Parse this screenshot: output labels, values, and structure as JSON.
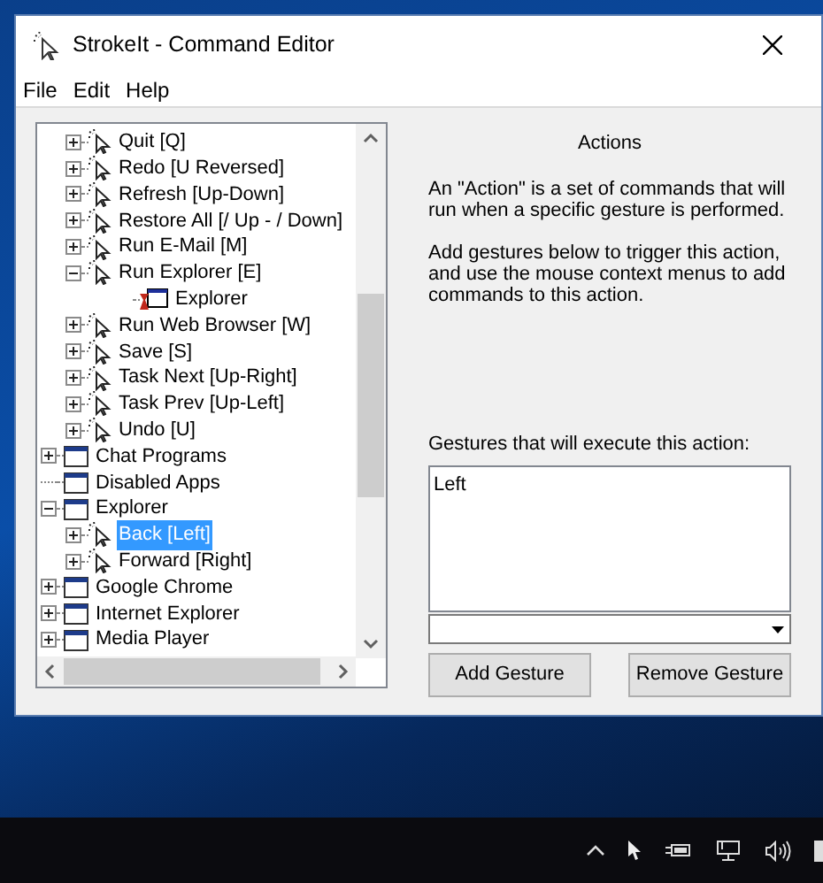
{
  "window": {
    "title": "StrokeIt - Command Editor"
  },
  "menu": [
    "File",
    "Edit",
    "Help"
  ],
  "tree": {
    "items": [
      {
        "label": "Quit [Q]",
        "kind": "action",
        "expanded": false,
        "selected": false
      },
      {
        "label": "Redo [U Reversed]",
        "kind": "action",
        "expanded": false,
        "selected": false
      },
      {
        "label": "Refresh [Up-Down]",
        "kind": "action",
        "expanded": false,
        "selected": false
      },
      {
        "label": "Restore All [/ Up - / Down]",
        "kind": "action",
        "expanded": false,
        "selected": false
      },
      {
        "label": "Run E-Mail [M]",
        "kind": "action",
        "expanded": false,
        "selected": false
      },
      {
        "label": "Run Explorer [E]",
        "kind": "action",
        "expanded": true,
        "selected": false,
        "children": [
          {
            "label": "Explorer",
            "kind": "command",
            "selected": false
          }
        ]
      },
      {
        "label": "Run Web Browser [W]",
        "kind": "action",
        "expanded": false,
        "selected": false
      },
      {
        "label": "Save [S]",
        "kind": "action",
        "expanded": false,
        "selected": false
      },
      {
        "label": "Task Next [Up-Right]",
        "kind": "action",
        "expanded": false,
        "selected": false
      },
      {
        "label": "Task Prev [Up-Left]",
        "kind": "action",
        "expanded": false,
        "selected": false
      },
      {
        "label": "Undo [U]",
        "kind": "action",
        "expanded": false,
        "selected": false
      },
      {
        "label": "Chat Programs",
        "kind": "group",
        "expanded": false,
        "selected": false
      },
      {
        "label": "Disabled Apps",
        "kind": "group",
        "selected": false
      },
      {
        "label": "Explorer",
        "kind": "group",
        "expanded": true,
        "selected": false,
        "children": [
          {
            "label": "Back [Left]",
            "kind": "action",
            "expanded": false,
            "selected": true
          },
          {
            "label": "Forward [Right]",
            "kind": "action",
            "expanded": false,
            "selected": false
          }
        ]
      },
      {
        "label": "Google Chrome",
        "kind": "group",
        "expanded": false,
        "selected": false
      },
      {
        "label": "Internet Explorer",
        "kind": "group",
        "expanded": false,
        "selected": false
      },
      {
        "label": "Media Player",
        "kind": "group",
        "expanded": false,
        "selected": false
      }
    ]
  },
  "panel": {
    "heading": "Actions",
    "paragraphs": [
      "An \"Action\" is a set of commands that will run when a specific gesture is performed.",
      "Add gestures below to trigger this action, and use the mouse context menus to add commands to this action."
    ],
    "gestures_label": "Gestures that will execute this action:",
    "gestures": [
      "Left"
    ],
    "buttons": [
      "Add Gesture",
      "Remove Gesture"
    ]
  }
}
